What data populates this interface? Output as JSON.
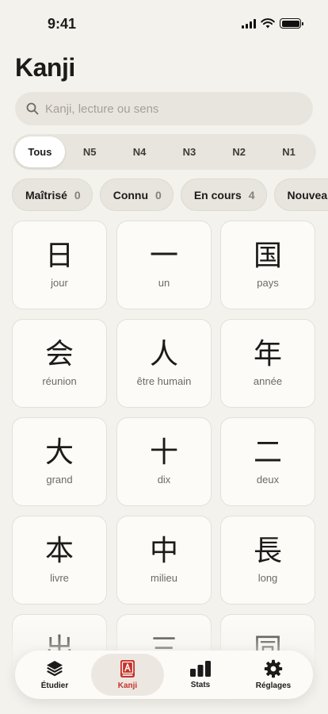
{
  "status_bar": {
    "time": "9:41"
  },
  "header": {
    "title": "Kanji"
  },
  "search": {
    "placeholder": "Kanji, lecture ou sens",
    "value": ""
  },
  "levels": [
    "Tous",
    "N5",
    "N4",
    "N3",
    "N2",
    "N1"
  ],
  "selected_level": "Tous",
  "filters": [
    {
      "label": "Maîtrisé",
      "count": "0"
    },
    {
      "label": "Connu",
      "count": "0"
    },
    {
      "label": "En cours",
      "count": "4"
    },
    {
      "label": "Nouveau",
      "count": ""
    }
  ],
  "kanji": [
    {
      "char": "日",
      "meaning": "jour"
    },
    {
      "char": "一",
      "meaning": "un"
    },
    {
      "char": "国",
      "meaning": "pays"
    },
    {
      "char": "会",
      "meaning": "réunion"
    },
    {
      "char": "人",
      "meaning": "être humain"
    },
    {
      "char": "年",
      "meaning": "année"
    },
    {
      "char": "大",
      "meaning": "grand"
    },
    {
      "char": "十",
      "meaning": "dix"
    },
    {
      "char": "二",
      "meaning": "deux"
    },
    {
      "char": "本",
      "meaning": "livre"
    },
    {
      "char": "中",
      "meaning": "milieu"
    },
    {
      "char": "長",
      "meaning": "long"
    },
    {
      "char": "出",
      "meaning": ""
    },
    {
      "char": "三",
      "meaning": ""
    },
    {
      "char": "同",
      "meaning": ""
    }
  ],
  "tabbar": {
    "items": [
      {
        "label": "Étudier",
        "icon": "stack-icon"
      },
      {
        "label": "Kanji",
        "icon": "kanji-book-icon"
      },
      {
        "label": "Stats",
        "icon": "bar-chart-icon"
      },
      {
        "label": "Réglages",
        "icon": "gear-icon"
      }
    ],
    "active": "Kanji",
    "accent_color": "#C8312A"
  }
}
